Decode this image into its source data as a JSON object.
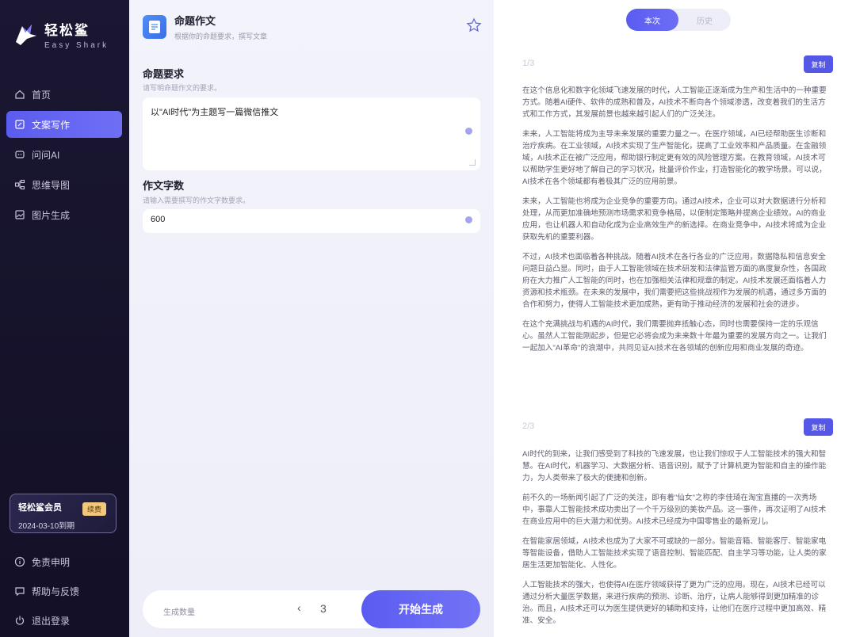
{
  "app": {
    "name_cn": "轻松鲨",
    "name_en": "Easy Shark"
  },
  "nav": [
    {
      "label": "首页",
      "icon": "home-icon",
      "active": false
    },
    {
      "label": "文案写作",
      "icon": "edit-icon",
      "active": true
    },
    {
      "label": "问问AI",
      "icon": "chat-icon",
      "active": false
    },
    {
      "label": "思维导图",
      "icon": "mindmap-icon",
      "active": false
    },
    {
      "label": "图片生成",
      "icon": "image-icon",
      "active": false
    }
  ],
  "member": {
    "title": "轻松鲨会员",
    "renew": "续费",
    "expire": "2024-03-10到期"
  },
  "bottom_nav": [
    {
      "label": "免责申明",
      "icon": "info-icon"
    },
    {
      "label": "帮助与反馈",
      "icon": "feedback-icon"
    },
    {
      "label": "退出登录",
      "icon": "power-icon"
    }
  ],
  "form": {
    "title": "命题作文",
    "subtitle": "根据你的命题要求，撰写文章",
    "req_title": "命题要求",
    "req_hint": "请写明命题作文的要求。",
    "req_value": "以\"AI时代\"为主题写一篇微信推文",
    "count_title": "作文字数",
    "count_hint": "请输入需要撰写的作文字数要求。",
    "count_value": "600",
    "qty_label": "生成数量",
    "qty_left": "‹",
    "qty_value": "3",
    "generate": "开始生成"
  },
  "tabs": {
    "current": "本次",
    "history": "历史"
  },
  "colors": {
    "accent": "#5a5cf1",
    "sidebar_bg": "#1b1733",
    "gold": "#f2c87a"
  },
  "results": [
    {
      "num": "1/3",
      "copy": "复制",
      "paragraphs": [
        "在这个信息化和数字化领域飞速发展的时代，人工智能正逐渐成为生产和生活中的一种重要方式。随着AI硬件、软件的成熟和普及，AI技术不断向各个领域渗透，改变着我们的生活方式和工作方式，其发展前景也越来越引起人们的广泛关注。",
        "未来，人工智能将成为主导未来发展的重要力量之一。在医疗领域，AI已经帮助医生诊断和治疗疾病。在工业领域，AI技术实现了生产智能化，提高了工业效率和产品质量。在金融领域，AI技术正在被广泛应用，帮助银行制定更有效的风险管理方案。在教育领域，AI技术可以帮助学生更好地了解自己的学习状况，批量评价作业，打造智能化的教学场景。可以说，AI技术在各个领域都有着极其广泛的应用前景。",
        "未来，人工智能也将成为企业竞争的重要方向。通过AI技术，企业可以对大数据进行分析和处理，从而更加准确地预测市场需求和竞争格局，以便制定策略并提高企业绩效。AI的商业应用，也让机器人和自动化成为企业高效生产的新选择。在商业竞争中，AI技术将成为企业获取先机的重要利器。",
        "不过，AI技术也面临着各种挑战。随着AI技术在各行各业的广泛应用，数据隐私和信息安全问题日益凸显。同时，由于人工智能领域在技术研发和法律监管方面的高度复杂性，各国政府在大力推广人工智能的同时，也在加强相关法律和规章的制定。AI技术发展还面临着人力资源和技术瓶颈。在未来的发展中，我们需要把这些挑战视作为发展的机遇，通过多方面的合作和努力，使得人工智能技术更加成熟，更有助于推动经济的发展和社会的进步。",
        "在这个充满挑战与机遇的AI时代，我们需要抛弃抵触心态，同时也需要保持一定的乐观信心。虽然人工智能刚起步，但是它必将会成为未来数十年最为重要的发展方向之一。让我们一起加入\"AI革命\"的浪潮中，共同见证AI技术在各领域的创新应用和商业发展的奇迹。"
      ]
    },
    {
      "num": "2/3",
      "copy": "复制",
      "paragraphs": [
        "AI时代的到来，让我们感受到了科技的飞速发展，也让我们惊叹于人工智能技术的强大和智慧。在AI时代，机器学习、大数据分析、语音识别，赋予了计算机更为智能和自主的操作能力，为人类带来了极大的便捷和创新。",
        "前不久的一场新闻引起了广泛的关注，即有着\"仙女\"之称的李佳琦在淘宝直播的一次秀场中，事靠人工智能技术成功卖出了一个千万级别的美妆产品。这一事件，再次证明了AI技术在商业应用中的巨大潜力和优势。AI技术已经成为中国零售业的最新宠儿。",
        "在智能家居领域，AI技术也成为了大家不可或缺的一部分。智能音箱、智能客厅、智能家电等智能设备，借助人工智能技术实现了语音控制、智能匹配、自主学习等功能，让人类的家居生活更加智能化、人性化。",
        "人工智能技术的强大，也使得AI在医疗领域获得了更为广泛的应用。现在，AI技术已经可以通过分析大量医学数据，来进行疾病的预测、诊断、治疗，让病人能够得到更加精准的诊治。而且，AI技术还可以为医生提供更好的辅助和支持，让他们在医疗过程中更加高效、精准、安全。"
      ]
    }
  ]
}
